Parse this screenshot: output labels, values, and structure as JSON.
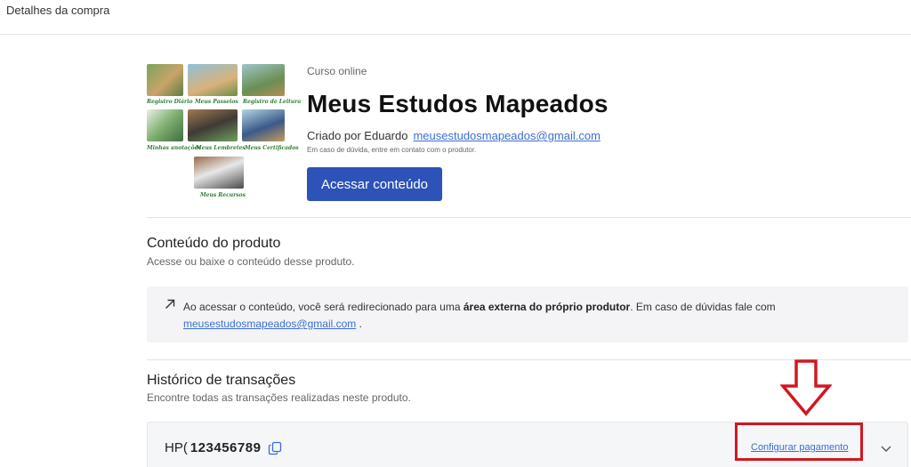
{
  "page": {
    "title": "Detalhes da compra"
  },
  "course": {
    "type": "Curso online",
    "title": "Meus Estudos Mapeados",
    "creator_prefix": "Criado por Eduardo",
    "creator_email": "meusestudosmapeados@gmail.com",
    "help_note": "Em caso de dúvida, entre em contato com o produtor.",
    "access_button": "Acessar conteúdo",
    "thumbnail_captions": [
      "Registro Diário",
      "Meus Passeios",
      "Registro de Leitura",
      "Minhas anotações",
      "Meus Lembretes",
      "Meus Certificados",
      "Meus Recursos"
    ]
  },
  "content_section": {
    "title": "Conteúdo do produto",
    "subtitle": "Acesse ou baixe o conteúdo desse produto.",
    "notice_text_1": "Ao acessar o conteúdo, você será redirecionado para uma ",
    "notice_bold": "área externa do próprio produtor",
    "notice_text_2": ". Em caso de dúvidas fale com",
    "notice_email": "meusestudosmapeados@gmail.com",
    "notice_end": "."
  },
  "transactions": {
    "title": "Histórico de transações",
    "subtitle": "Encontre todas as transações realizadas neste produto.",
    "rows": [
      {
        "prefix": "HP(",
        "code": "123456789",
        "action": "Configurar pagamento"
      }
    ]
  },
  "colors": {
    "primary": "#2d52b8",
    "link": "#3b6fd1",
    "highlight": "#d01820",
    "notice_bg": "#f4f4f6"
  }
}
